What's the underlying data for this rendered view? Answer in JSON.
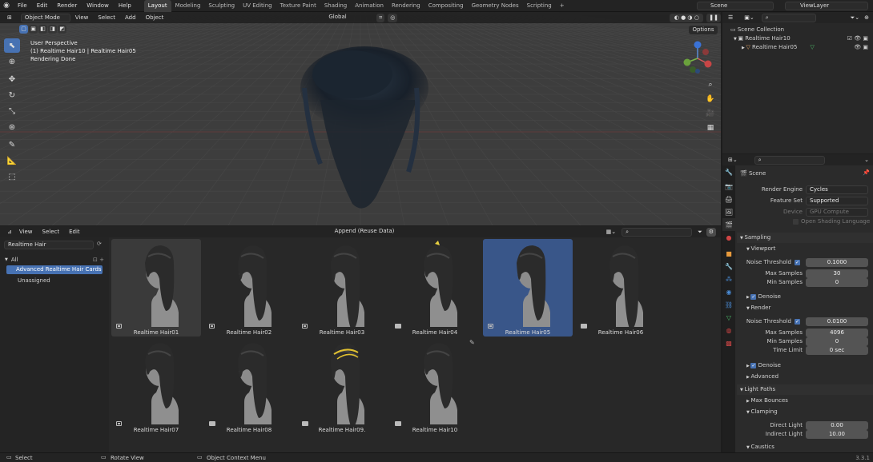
{
  "menu": [
    "File",
    "Edit",
    "Render",
    "Window",
    "Help"
  ],
  "workspaces": [
    "Layout",
    "Modeling",
    "Sculpting",
    "UV Editing",
    "Texture Paint",
    "Shading",
    "Animation",
    "Rendering",
    "Compositing",
    "Geometry Nodes",
    "Scripting"
  ],
  "active_workspace": "Layout",
  "scene_name": "Scene",
  "view_layer": "ViewLayer",
  "viewport": {
    "mode": "Object Mode",
    "menus": [
      "View",
      "Select",
      "Add",
      "Object"
    ],
    "transform": "Global",
    "options_label": "Options",
    "overlay_lines": [
      "User Perspective",
      "(1) Realtime Hair10 | Realtime Hair05",
      "Rendering Done"
    ]
  },
  "browser": {
    "menus": [
      "View",
      "Select",
      "Edit"
    ],
    "import_method": "Append (Reuse Data)",
    "library": "Realtime Hair",
    "catalogs": [
      "All",
      "Advanced Realtime Hair Cards",
      "Unassigned"
    ],
    "selected_catalog": "Advanced Realtime Hair Cards",
    "assets": [
      {
        "name": "Realtime Hair01",
        "state": "hover",
        "badge": "sq"
      },
      {
        "name": "Realtime Hair02",
        "state": "",
        "badge": "sq"
      },
      {
        "name": "Realtime Hair03",
        "state": "",
        "badge": "sq"
      },
      {
        "name": "Realtime Hair04",
        "state": "",
        "badge": "arch"
      },
      {
        "name": "Realtime Hair05",
        "state": "selected",
        "badge": "sq"
      },
      {
        "name": "Realtime Hair06",
        "state": "",
        "badge": "arch"
      },
      {
        "name": "Realtime Hair07",
        "state": "",
        "badge": "sq"
      },
      {
        "name": "Realtime Hair08",
        "state": "",
        "badge": "arch"
      },
      {
        "name": "Realtime Hair09.",
        "state": "",
        "badge": "arch"
      },
      {
        "name": "Realtime Hair10",
        "state": "",
        "badge": "arch"
      }
    ]
  },
  "outliner": {
    "root": "Scene Collection",
    "items": [
      "Realtime Hair10",
      "Realtime Hair05"
    ]
  },
  "properties": {
    "context": "Scene",
    "render_engine_label": "Render Engine",
    "render_engine": "Cycles",
    "feature_set_label": "Feature Set",
    "feature_set": "Supported",
    "device_label": "Device",
    "device": "GPU Compute",
    "osl_label": "Open Shading Language",
    "sampling": "Sampling",
    "viewport_sub": "Viewport",
    "vp_noise_label": "Noise Threshold",
    "vp_noise": "0.1000",
    "vp_max_label": "Max Samples",
    "vp_max": "30",
    "vp_min_label": "Min Samples",
    "vp_min": "0",
    "denoise": "Denoise",
    "render_sub": "Render",
    "r_noise_label": "Noise Threshold",
    "r_noise": "0.0100",
    "r_max_label": "Max Samples",
    "r_max": "4096",
    "r_min_label": "Min Samples",
    "r_min": "0",
    "time_label": "Time Limit",
    "time": "0 sec",
    "denoise2": "Denoise",
    "advanced": "Advanced",
    "light_paths": "Light Paths",
    "max_bounces": "Max Bounces",
    "clamping": "Clamping",
    "direct_label": "Direct Light",
    "direct": "0.00",
    "indirect_label": "Indirect Light",
    "indirect": "10.00",
    "caustics": "Caustics"
  },
  "status": {
    "select": "Select",
    "rotate": "Rotate View",
    "context": "Object Context Menu",
    "version": "3.3.1"
  },
  "colors": {
    "accent": "#4772b3",
    "selected_tile": "#395689"
  }
}
